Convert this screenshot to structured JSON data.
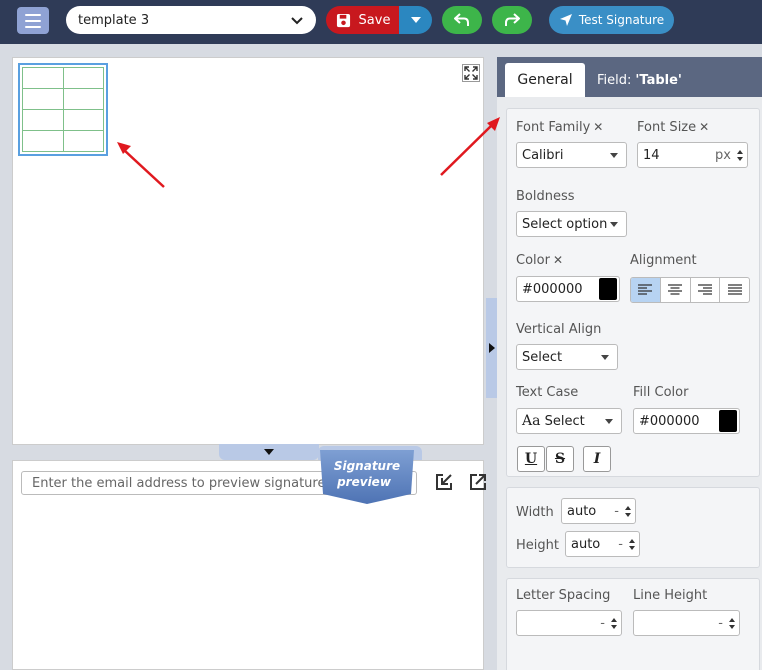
{
  "toolbar": {
    "template_name": "template 3",
    "save_label": "Save",
    "test_label": "Test Signature"
  },
  "preview": {
    "badge_line1": "Signature",
    "badge_line2": "preview",
    "email_placeholder": "Enter the email address to preview signature for"
  },
  "panel": {
    "tab_general": "General",
    "tab_field_prefix": "Field:",
    "tab_field_name": "'Table'",
    "font_family_label": "Font Family",
    "font_family_value": "Calibri",
    "font_size_label": "Font Size",
    "font_size_value": "14",
    "font_size_unit": "px",
    "boldness_label": "Boldness",
    "boldness_value": "Select option",
    "color_label": "Color",
    "color_value": "#000000",
    "alignment_label": "Alignment",
    "alignment_active": "left",
    "vertical_align_label": "Vertical Align",
    "vertical_align_value": "Select",
    "text_case_label": "Text Case",
    "text_case_prefix": "Aa",
    "text_case_value": "Select",
    "fill_color_label": "Fill Color",
    "fill_color_value": "#000000",
    "underline_label": "U",
    "strike_label": "S",
    "italic_label": "I",
    "width_label": "Width",
    "width_value": "auto",
    "height_label": "Height",
    "height_value": "auto",
    "spin_dash": "-",
    "letter_spacing_label": "Letter Spacing",
    "line_height_label": "Line Height",
    "x_mark": "✕"
  },
  "colors": {
    "topbar": "#2f3b57",
    "save": "#c8181e",
    "save_dropdown": "#2b87c0",
    "undo_redo": "#3db54a",
    "test": "#3a8fc6",
    "annotation_arrow": "#e0191f",
    "table_grid": "#7fc08a",
    "table_selection": "#5aa0e0"
  }
}
